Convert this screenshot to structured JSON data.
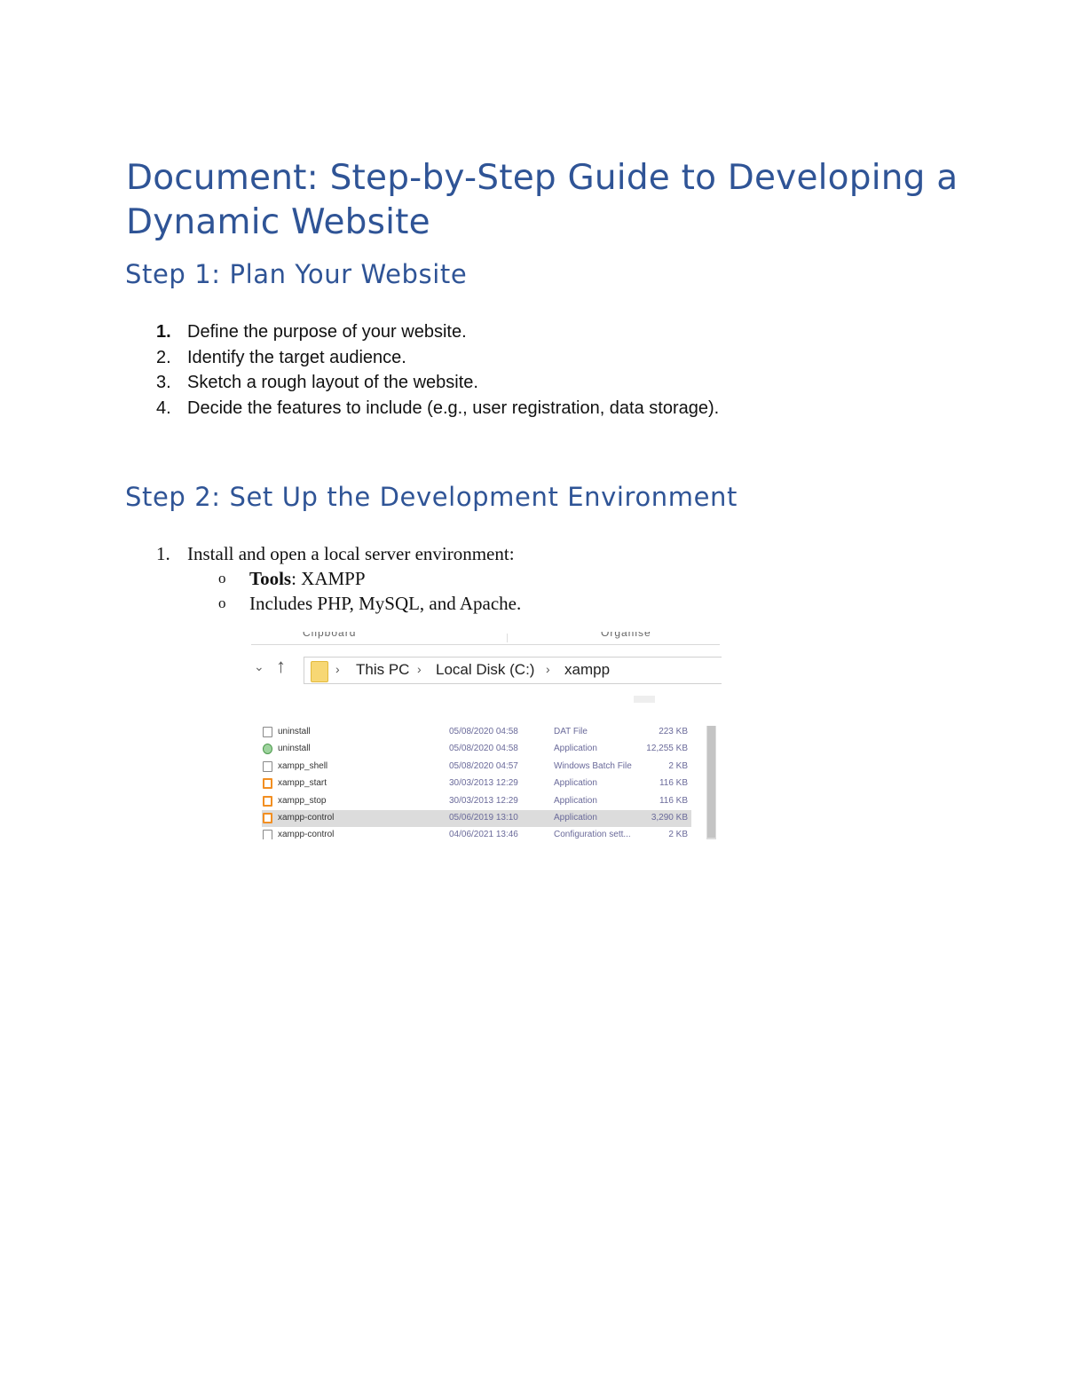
{
  "document": {
    "title": "Document: Step-by-Step Guide to Developing a Dynamic Website",
    "step1": {
      "heading": "Step 1: Plan Your Website",
      "items": [
        {
          "num": "1.",
          "text": "Define the purpose of your website."
        },
        {
          "num": "2.",
          "text": "Identify the target audience."
        },
        {
          "num": "3.",
          "text": "Sketch a rough layout of the website."
        },
        {
          "num": "4.",
          "text": "Decide the features to include (e.g., user registration, data storage)."
        }
      ]
    },
    "step2": {
      "heading": "Step 2: Set Up the Development Environment",
      "item1": {
        "num": "1.",
        "text": "Install and open a local server environment:"
      },
      "bullets": [
        {
          "bullet": "o",
          "label": "Tools",
          "text": ": XAMPP"
        },
        {
          "bullet": "o",
          "label": "",
          "text": "Includes PHP, MySQL, and Apache."
        }
      ]
    }
  },
  "screenshot": {
    "ribbon": {
      "left": "Clipboard",
      "right": "Organise"
    },
    "breadcrumb": [
      "This PC",
      "Local Disk (C:)",
      "xampp"
    ],
    "files": [
      {
        "name": "uninstall",
        "date": "05/08/2020 04:58",
        "type": "DAT File",
        "size": "223 KB",
        "icon": "file-icon"
      },
      {
        "name": "uninstall",
        "date": "05/08/2020 04:58",
        "type": "Application",
        "size": "12,255 KB",
        "icon": "gear-icon"
      },
      {
        "name": "xampp_shell",
        "date": "05/08/2020 04:57",
        "type": "Windows Batch File",
        "size": "2 KB",
        "icon": "batch-icon"
      },
      {
        "name": "xampp_start",
        "date": "30/03/2013 12:29",
        "type": "Application",
        "size": "116 KB",
        "icon": "xampp-icon"
      },
      {
        "name": "xampp_stop",
        "date": "30/03/2013 12:29",
        "type": "Application",
        "size": "116 KB",
        "icon": "xampp-icon"
      },
      {
        "name": "xampp-control",
        "date": "05/06/2019 13:10",
        "type": "Application",
        "size": "3,290 KB",
        "icon": "xampp-icon",
        "selected": true
      },
      {
        "name": "xampp-control",
        "date": "04/06/2021 13:46",
        "type": "Configuration sett...",
        "size": "2 KB",
        "icon": "config-icon"
      }
    ]
  }
}
